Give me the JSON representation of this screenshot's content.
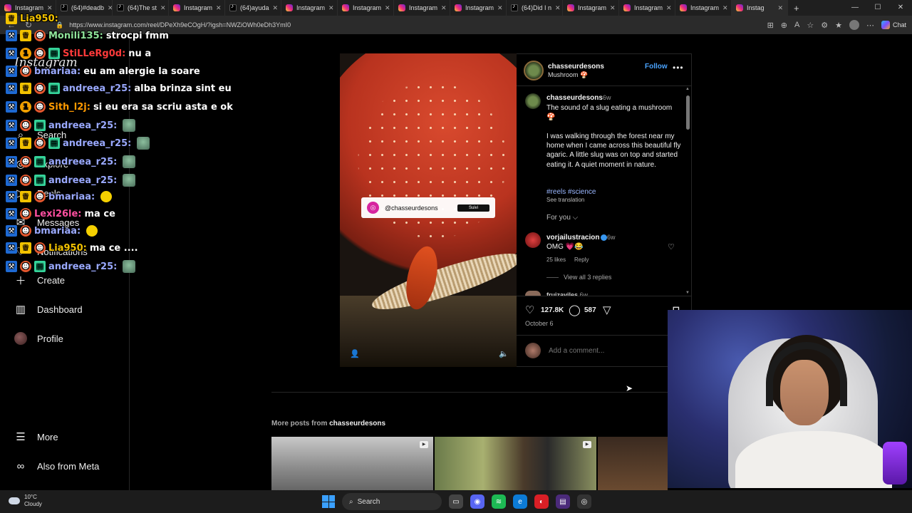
{
  "browser": {
    "tabs": [
      {
        "label": "Instagram",
        "icon": "instagram"
      },
      {
        "label": "(64)#deadb",
        "icon": "tiktok"
      },
      {
        "label": "(64)The st",
        "icon": "tiktok"
      },
      {
        "label": "Instagram",
        "icon": "instagram"
      },
      {
        "label": "(64)ayuda",
        "icon": "tiktok"
      },
      {
        "label": "Instagram",
        "icon": "instagram"
      },
      {
        "label": "Instagram",
        "icon": "instagram"
      },
      {
        "label": "Instagram",
        "icon": "instagram"
      },
      {
        "label": "Instagram",
        "icon": "instagram"
      },
      {
        "label": "(64)Did I n",
        "icon": "tiktok"
      },
      {
        "label": "Instagram",
        "icon": "instagram"
      },
      {
        "label": "Instagram",
        "icon": "instagram"
      },
      {
        "label": "Instagram",
        "icon": "instagram"
      },
      {
        "label": "Instag",
        "icon": "instagram",
        "active": true
      }
    ],
    "url": "https://www.instagram.com/reel/DPeXh9eCOgH/?igsh=NWZiOWh0eDh3YmI0",
    "chat_label": "Chat"
  },
  "sidebar": {
    "logo": "Instagram",
    "items": [
      {
        "label": "Search",
        "icon": "search-icon"
      },
      {
        "label": "Explore",
        "icon": "compass-icon"
      },
      {
        "label": "Reels",
        "icon": "reels-icon"
      },
      {
        "label": "Messages",
        "icon": "messages-icon"
      },
      {
        "label": "Notifications",
        "icon": "heart-icon"
      },
      {
        "label": "Create",
        "icon": "plus-icon"
      },
      {
        "label": "Dashboard",
        "icon": "dashboard-icon"
      },
      {
        "label": "Profile",
        "icon": "profile-icon"
      },
      {
        "label": "More",
        "icon": "menu-icon"
      },
      {
        "label": "Also from Meta",
        "icon": "meta-icon"
      }
    ]
  },
  "chat": {
    "lines": [
      {
        "user": "Monili135:",
        "msg": "strocpi fmm",
        "color": "#8fe39a"
      },
      {
        "user": "StiLLeRg0d:",
        "msg": "nu a",
        "color": "#ff3a3a"
      },
      {
        "user": "bmariaa:",
        "msg": "eu am alergie la soare",
        "color": "#9aa9ff"
      },
      {
        "user": "andreea_r25:",
        "msg": "alba brinza sint eu",
        "color": "#9aa9ff"
      },
      {
        "user": "Sith_l2j:",
        "msg": "si eu era sa scriu asta e ok",
        "color": "#ff9a00"
      },
      {
        "user": "andreea_r25:",
        "msg": "",
        "color": "#9aa9ff"
      },
      {
        "user": "andreea_r25:",
        "msg": "",
        "color": "#9aa9ff"
      },
      {
        "user": "andreea_r25:",
        "msg": "",
        "color": "#9aa9ff"
      },
      {
        "user": "andreea_r25:",
        "msg": "",
        "color": "#9aa9ff"
      },
      {
        "user": "bmariaa:",
        "msg": "",
        "color": "#9aa9ff"
      },
      {
        "user": "Lexi26le:",
        "msg": "ma ce",
        "color": "#ff4fa0"
      },
      {
        "user": "bmariaa:",
        "msg": "",
        "color": "#9aa9ff"
      },
      {
        "user": "Lia950:",
        "msg": "ma ce ....",
        "color": "#f2c200"
      },
      {
        "user": "andreea_r25:",
        "msg": "",
        "color": "#9aa9ff"
      }
    ],
    "header_user": "Lia950:"
  },
  "reel": {
    "tag_handle": "@chasseurdesons",
    "tag_button": "Suivi"
  },
  "post": {
    "username": "chasseurdesons",
    "subtitle": "Mushroom 🍄",
    "follow_label": "Follow",
    "caption_user": "chasseurdesons",
    "caption_time": "6w",
    "caption": "The sound of a slug eating a mushroom\n🍄\n\nI was walking through the forest near my home when I came across this beautiful fly agaric. A little slug was on top and started eating it. A quiet moment in nature.",
    "hashtags": "#reels #science",
    "see_translation": "See translation",
    "for_you": "For you ⌵",
    "comment": {
      "user": "vorjailustracion",
      "time": "6w",
      "text": "OMG 💗😂",
      "likes": "25 likes",
      "reply": "Reply",
      "view_replies": "View all 3 replies"
    },
    "comment2_user": "fruizaviles",
    "comment2_time": "6w",
    "likes_count": "127.8K",
    "comments_count": "587",
    "date": "October 6",
    "add_comment_placeholder": "Add a comment..."
  },
  "more_posts": {
    "prefix": "More posts from",
    "user": "chasseurdesons"
  },
  "taskbar": {
    "temp": "10°C",
    "weather": "Cloudy",
    "search": "Search"
  }
}
